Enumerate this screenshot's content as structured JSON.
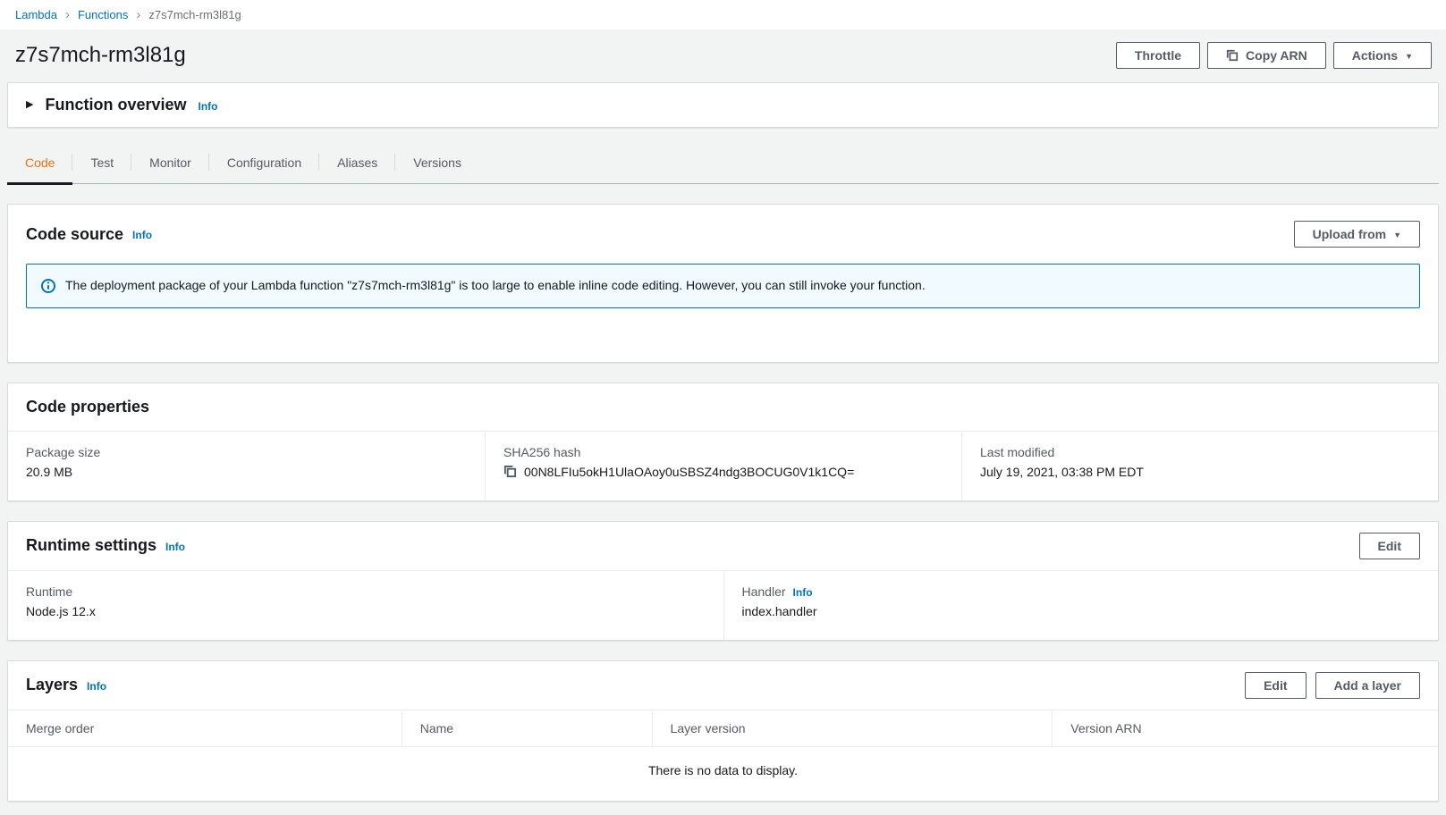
{
  "breadcrumb": {
    "items": [
      "Lambda",
      "Functions",
      "z7s7mch-rm3l81g"
    ]
  },
  "header": {
    "title": "z7s7mch-rm3l81g",
    "throttle_button": "Throttle",
    "copy_arn_button": "Copy ARN",
    "actions_button": "Actions"
  },
  "function_overview": {
    "title": "Function overview",
    "info_label": "Info"
  },
  "tabs": [
    "Code",
    "Test",
    "Monitor",
    "Configuration",
    "Aliases",
    "Versions"
  ],
  "code_source": {
    "title": "Code source",
    "info_label": "Info",
    "upload_from_button": "Upload from",
    "alert_text": "The deployment package of your Lambda function \"z7s7mch-rm3l81g\" is too large to enable inline code editing. However, you can still invoke your function."
  },
  "code_properties": {
    "title": "Code properties",
    "fields": [
      {
        "label": "Package size",
        "value": "20.9 MB"
      },
      {
        "label": "SHA256 hash",
        "value": "00N8LFIu5okH1UlaOAoy0uSBSZ4ndg3BOCUG0V1k1CQ="
      },
      {
        "label": "Last modified",
        "value": "July 19, 2021, 03:38 PM EDT"
      }
    ]
  },
  "runtime_settings": {
    "title": "Runtime settings",
    "info_label": "Info",
    "edit_button": "Edit",
    "runtime": {
      "label": "Runtime",
      "value": "Node.js 12.x"
    },
    "handler": {
      "label": "Handler",
      "info_label": "Info",
      "value": "index.handler"
    }
  },
  "layers": {
    "title": "Layers",
    "info_label": "Info",
    "edit_button": "Edit",
    "add_layer_button": "Add a layer",
    "columns": [
      "Merge order",
      "Name",
      "Layer version",
      "Version ARN"
    ],
    "empty_message": "There is no data to display."
  },
  "colors": {
    "accent_orange": "#ec7211",
    "link_blue": "#0073bb",
    "alert_background": "#f1faff",
    "page_background": "#f2f3f3"
  }
}
